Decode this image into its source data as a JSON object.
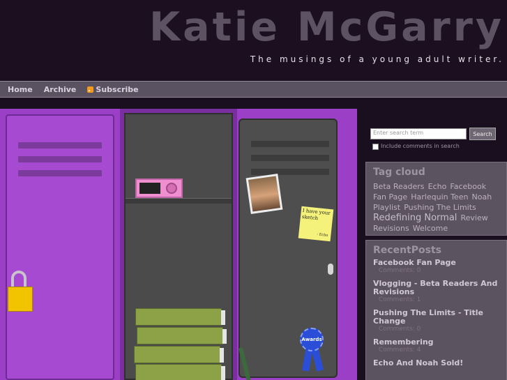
{
  "header": {
    "title": "Katie McGarry",
    "tagline": "The musings of a young adult writer."
  },
  "nav": {
    "items": [
      "Home",
      "Archive",
      "Subscribe"
    ]
  },
  "search": {
    "placeholder": "Enter search term",
    "button_label": "Search",
    "include_comments_label": "Include comments in search",
    "include_comments_checked": false
  },
  "tag_cloud": {
    "title": "Tag cloud",
    "tags": [
      "Beta Readers",
      "Echo",
      "Facebook Fan Page",
      "Harlequin Teen",
      "Noah",
      "Playlist",
      "Pushing The Limits",
      "Redefining Normal",
      "Review",
      "Revisions",
      "Welcome"
    ]
  },
  "recent_posts": {
    "title": "RecentPosts",
    "posts": [
      {
        "title": "Facebook Fan Page",
        "comments": "Comments: 0"
      },
      {
        "title": "Vlogging - Beta Readers And Revisions",
        "comments": "Comments: 1"
      },
      {
        "title": "Pushing The Limits - Title Change",
        "comments": "Comments: 0"
      },
      {
        "title": "Remembering",
        "comments": "Comments: 4"
      },
      {
        "title": "Echo And Noah Sold!",
        "comments": ""
      }
    ]
  },
  "lockers": {
    "sticky_note": "I have your sketch",
    "sticky_signature": "- Echo",
    "award": "Awards"
  }
}
